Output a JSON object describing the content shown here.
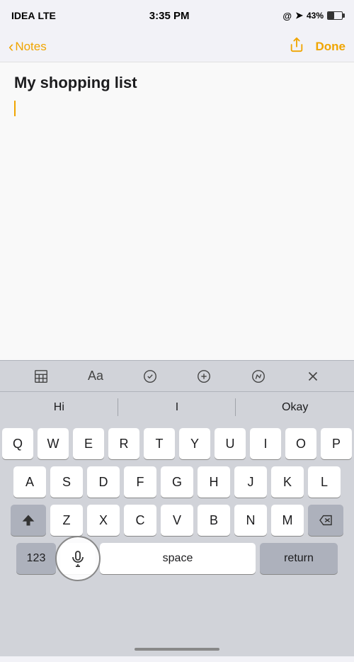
{
  "status": {
    "carrier": "IDEA",
    "network": "LTE",
    "time": "3:35 PM",
    "location_icon": "location-arrow-icon",
    "battery": "43%"
  },
  "nav": {
    "back_label": "Notes",
    "share_icon": "share-icon",
    "done_label": "Done"
  },
  "note": {
    "title": "My shopping list",
    "content": ""
  },
  "toolbar": {
    "table_icon": "table-icon",
    "format_icon": "format-text-icon",
    "checklist_icon": "checklist-icon",
    "add_icon": "add-icon",
    "markup_icon": "markup-icon",
    "close_icon": "close-icon"
  },
  "autocorrect": {
    "suggestions": [
      "Hi",
      "I",
      "Okay"
    ]
  },
  "keyboard": {
    "rows": [
      [
        "Q",
        "W",
        "E",
        "R",
        "T",
        "Y",
        "U",
        "I",
        "O",
        "P"
      ],
      [
        "A",
        "S",
        "D",
        "F",
        "G",
        "H",
        "J",
        "K",
        "L"
      ],
      [
        "Z",
        "X",
        "C",
        "V",
        "B",
        "N",
        "M"
      ],
      [
        "123",
        "space",
        "return"
      ]
    ],
    "space_label": "space",
    "return_label": "return",
    "numbers_label": "123"
  }
}
